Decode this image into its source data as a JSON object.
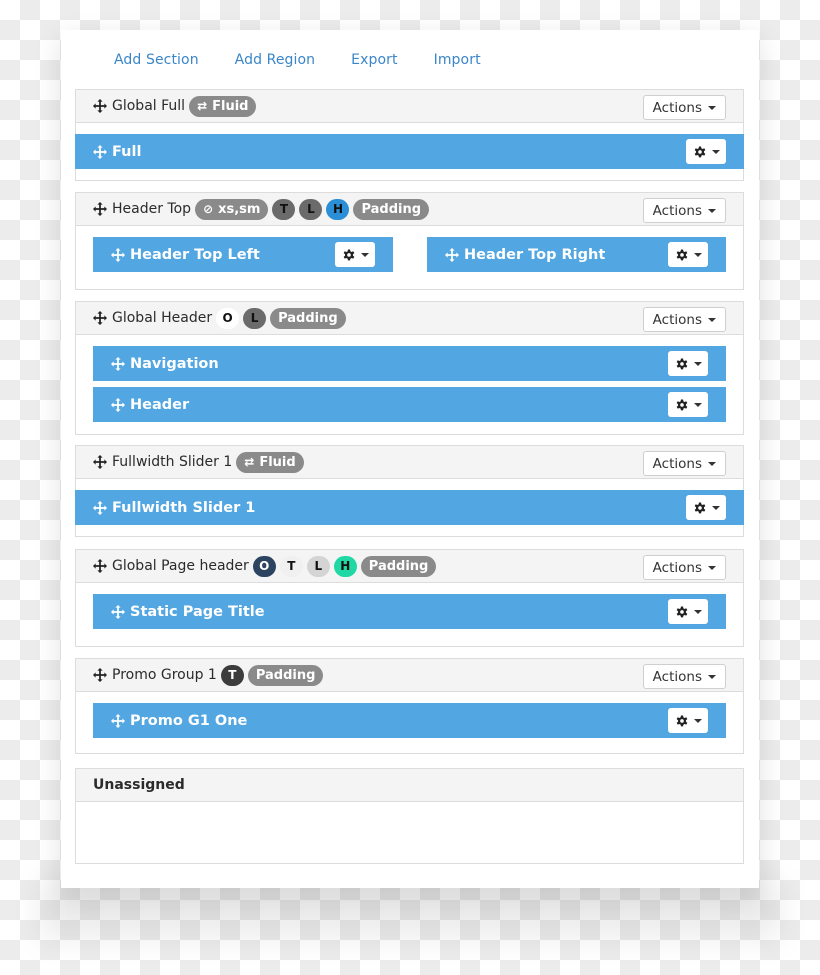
{
  "toolbar": {
    "add_section": "Add Section",
    "add_region": "Add Region",
    "export": "Export",
    "import": "Import"
  },
  "colors": {
    "link": "#3a86c8",
    "region_bg": "#52a6e1",
    "section_header_bg": "#f4f4f4"
  },
  "actions_label": "Actions",
  "sections": [
    {
      "title": "Global Full",
      "badges": [
        {
          "label": "Fluid",
          "icon": "exchange-icon",
          "style": "gray"
        }
      ],
      "regions": [
        "Full"
      ]
    },
    {
      "title": "Header Top",
      "badges": [
        {
          "label": "xs,sm",
          "icon": "eye-slash-icon",
          "style": "gray"
        },
        {
          "label": "T",
          "style": "dark"
        },
        {
          "label": "L",
          "style": "dark"
        },
        {
          "label": "H",
          "style": "blue"
        },
        {
          "label": "Padding",
          "style": "gray"
        }
      ],
      "regions": [
        "Header Top Left",
        "Header Top Right"
      ]
    },
    {
      "title": "Global Header",
      "badges": [
        {
          "label": "O",
          "style": "white"
        },
        {
          "label": "L",
          "style": "dark"
        },
        {
          "label": "Padding",
          "style": "gray"
        }
      ],
      "regions": [
        "Navigation",
        "Header"
      ]
    },
    {
      "title": "Fullwidth Slider 1",
      "badges": [
        {
          "label": "Fluid",
          "icon": "exchange-icon",
          "style": "gray"
        }
      ],
      "regions": [
        "Fullwidth Slider 1"
      ]
    },
    {
      "title": "Global Page header",
      "badges": [
        {
          "label": "O",
          "style": "navy"
        },
        {
          "label": "T",
          "style": "light"
        },
        {
          "label": "L",
          "style": "lightgray"
        },
        {
          "label": "H",
          "style": "teal"
        },
        {
          "label": "Padding",
          "style": "gray"
        }
      ],
      "regions": [
        "Static Page Title"
      ]
    },
    {
      "title": "Promo Group 1",
      "badges": [
        {
          "label": "T",
          "style": "darker"
        },
        {
          "label": "Padding",
          "style": "gray"
        }
      ],
      "regions": [
        "Promo G1 One"
      ]
    }
  ],
  "unassigned": {
    "title": "Unassigned"
  }
}
